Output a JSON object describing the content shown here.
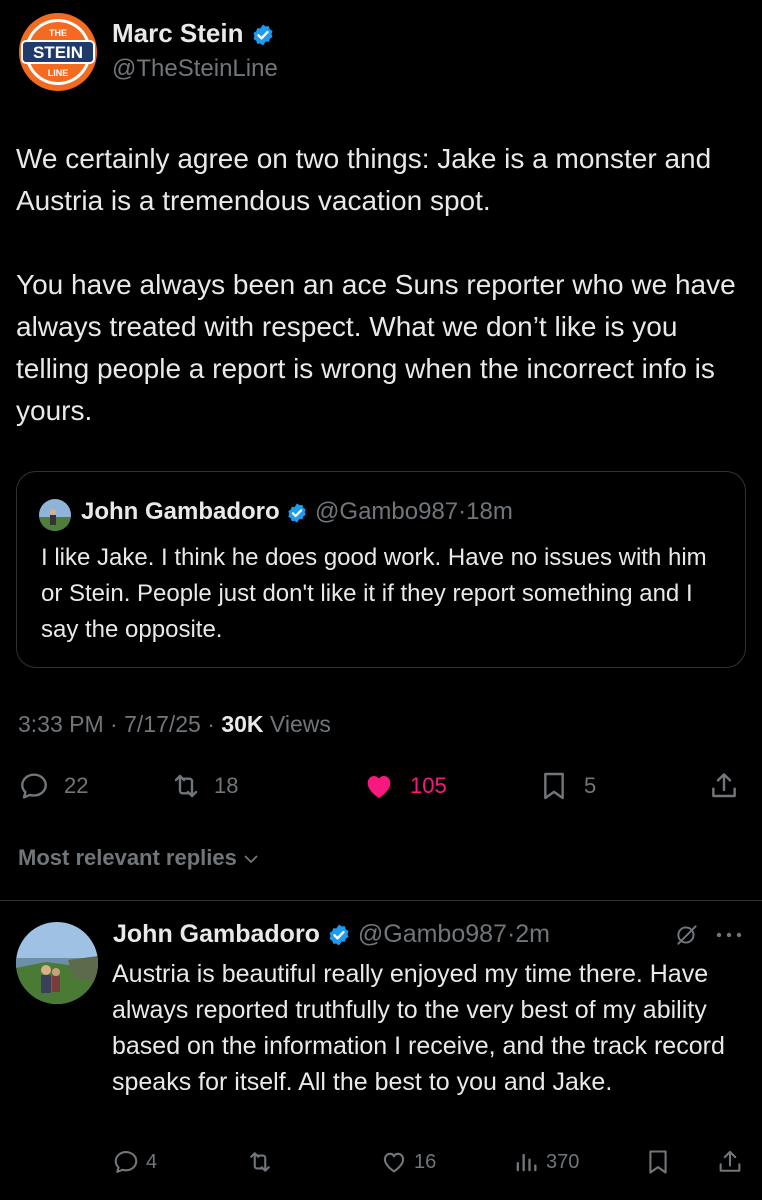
{
  "main_tweet": {
    "avatar": {
      "icon": "stein-line-logo",
      "logo_text_top": "THE",
      "logo_text_mid": "STEIN",
      "logo_text_bottom": "LINE"
    },
    "author_name": "Marc Stein",
    "handle": "@TheSteinLine",
    "verified": true,
    "paragraphs": [
      "We certainly agree on two things: Jake is a monster and Austria is a tremendous vacation spot.",
      "You have always been an ace Suns reporter who we have always treated with respect. What we don’t like is you telling people a report is wrong when the incorrect info is yours."
    ],
    "quote": {
      "author_name": "John Gambadoro",
      "handle": "@Gambo987",
      "separator": "·",
      "time": "18m",
      "text": "I like Jake. I think he does good work. Have no issues with him or Stein. People just don't like it if they report something and I say the opposite."
    },
    "time": "3:33 PM",
    "date": "7/17/25",
    "separator": "·",
    "views_count": "30K",
    "views_label": "Views",
    "actions": {
      "replies": "22",
      "reposts": "18",
      "likes": "105",
      "bookmarks": "5"
    },
    "like_color": "#f91880"
  },
  "replies_sort": {
    "label": "Most relevant replies",
    "icon": "chevron-down-icon"
  },
  "reply": {
    "author_name": "John Gambadoro",
    "handle": "@Gambo987",
    "separator": "·",
    "time": "2m",
    "text": "Austria is beautiful really enjoyed my time there. Have always reported truthfully to the very best of my ability based on the information I receive, and the track record speaks for itself. All the best to you and Jake.",
    "actions": {
      "replies": "4",
      "reposts": "",
      "likes": "16",
      "views": "370"
    }
  },
  "colors": {
    "background": "#000000",
    "text": "#e7e9ea",
    "secondary": "#71767b",
    "verified": "#1d9bf0",
    "border": "#2f3336"
  }
}
